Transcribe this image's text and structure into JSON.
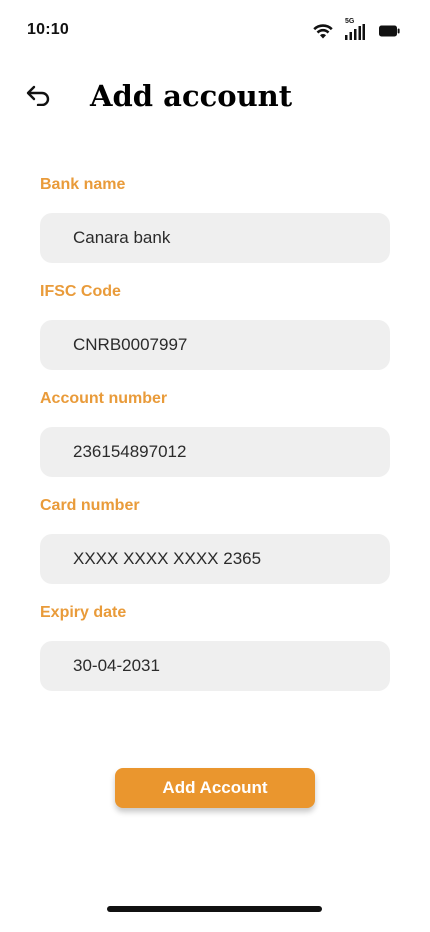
{
  "status_bar": {
    "time": "10:10",
    "network_label": "5G",
    "icons": [
      "wifi-icon",
      "cellular-signal-icon",
      "battery-icon"
    ]
  },
  "header": {
    "back_icon": "back-arrow-icon",
    "title": "Add account"
  },
  "form": {
    "fields": [
      {
        "label": "Bank name",
        "value": "Canara bank"
      },
      {
        "label": "IFSC Code",
        "value": "CNRB0007997"
      },
      {
        "label": "Account number",
        "value": "236154897012"
      },
      {
        "label": "Card number",
        "value": "XXXX XXXX XXXX 2365"
      },
      {
        "label": "Expiry date",
        "value": "30-04-2031"
      }
    ]
  },
  "submit": {
    "label": "Add Account"
  },
  "colors": {
    "accent": "#ea962e",
    "label": "#e99b3a",
    "input_background": "#efefef",
    "text": "#2b2b2b"
  }
}
